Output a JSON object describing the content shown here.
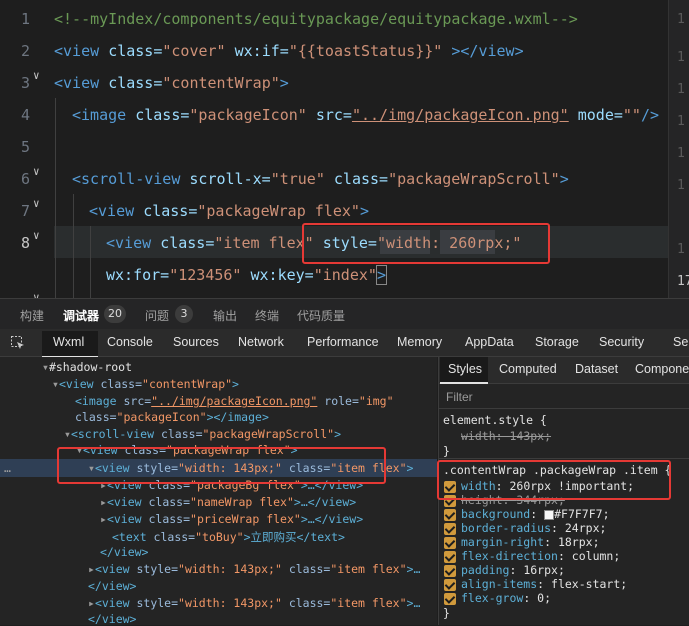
{
  "editor": {
    "line_numbers": [
      "1",
      "2",
      "3",
      "4",
      "5",
      "6",
      "7",
      "8"
    ],
    "lines": {
      "l1": "<!--myIndex/components/equitypackage/equitypackage.wxml-->",
      "l2": {
        "t1": "<view ",
        "a1": "class=",
        "v1": "\"cover\"",
        "a2": " wx:if=",
        "v2": "\"{{toastStatus}}\"",
        "t2": " ></view>"
      },
      "l3": {
        "t1": "<view ",
        "a1": "class=",
        "v1": "\"contentWrap\"",
        "t2": ">"
      },
      "l4": {
        "t1": "<image ",
        "a1": "class=",
        "v1": "\"packageIcon\"",
        "a2": " src=",
        "v2": "\"../img/packageIcon.png\"",
        "a3": " mode=",
        "v3": "\"\"",
        "t2": "/>"
      },
      "l6": {
        "t1": "<scroll-view ",
        "a1": "scroll-x=",
        "v1": "\"true\"",
        "a2": " class=",
        "v2": "\"packageWrapScroll\"",
        "t2": ">"
      },
      "l7": {
        "t1": "<view ",
        "a1": "class=",
        "v1": "\"packageWrap flex\"",
        "t2": ">"
      },
      "l8": {
        "t1": "<view ",
        "a1": "class=",
        "v1": "\"item flex\"",
        "a2": " style=",
        "v2": "\"width: 260rpx;\""
      },
      "l9": {
        "a1": "wx:for=",
        "v1": "\"123456\"",
        "a2": " wx:key=",
        "v2": "\"index\"",
        "t2": ">"
      }
    },
    "right_gutter": [
      "1",
      "1",
      "1",
      "1",
      "1",
      "1",
      "1",
      "17"
    ]
  },
  "panel_tabs": [
    {
      "label": "构建"
    },
    {
      "label": "调试器",
      "badge": "20"
    },
    {
      "label": "问题",
      "badge": "3"
    },
    {
      "label": "输出"
    },
    {
      "label": "终端"
    },
    {
      "label": "代码质量"
    }
  ],
  "devtools_tabs": [
    "Wxml",
    "Console",
    "Sources",
    "Network",
    "Performance",
    "Memory",
    "AppData",
    "Storage",
    "Security",
    "Sen"
  ],
  "tree": {
    "root": "#shadow-root",
    "r1": {
      "t": "<view ",
      "a": "class=",
      "v": "\"contentWrap\"",
      "e": ">"
    },
    "r2a": {
      "t": "<image ",
      "a": "src=",
      "v": "\"../img/packageIcon.png\"",
      "a2": " role=",
      "v2": "\"img\""
    },
    "r2b": {
      "a": "class=",
      "v": "\"packageIcon\"",
      "e": "></image>"
    },
    "r3": {
      "t": "<scroll-view ",
      "a": "class=",
      "v": "\"packageWrapScroll\"",
      "e": ">"
    },
    "r4": {
      "t": "<view ",
      "a": "class=",
      "v": "\"packageWrap flex\"",
      "e": ">"
    },
    "r5": {
      "t": "<view ",
      "a": "style=",
      "v": "\"width: 143px;\"",
      "a2": " class=",
      "v2": "\"item flex\"",
      "e": ">"
    },
    "r6": {
      "t": "<view ",
      "a": "class=",
      "v": "\"packageBg flex\"",
      "e": ">…</view>"
    },
    "r7": {
      "t": "<view ",
      "a": "class=",
      "v": "\"nameWrap flex\"",
      "e": ">…</view>"
    },
    "r8": {
      "t": "<view ",
      "a": "class=",
      "v": "\"priceWrap flex\"",
      "e": ">…</view>"
    },
    "r9": {
      "t": "<text ",
      "a": "class=",
      "v": "\"toBuy\"",
      "e": ">立即购买</text>"
    },
    "r10": "</view>",
    "r11": {
      "t": "<view ",
      "a": "style=",
      "v": "\"width: 143px;\"",
      "a2": " class=",
      "v2": "\"item flex\"",
      "e": ">…"
    },
    "r12": "</view>",
    "r13": {
      "t": "<view ",
      "a": "style=",
      "v": "\"width: 143px;\"",
      "a2": " class=",
      "v2": "\"item flex\"",
      "e": ">…"
    },
    "r14": "</view>",
    "ellipsis": "…"
  },
  "styles": {
    "tabs": [
      "Styles",
      "Computed",
      "Dataset",
      "Componen"
    ],
    "filter_placeholder": "Filter",
    "element_style": {
      "selector": "element.style {",
      "prop": "width",
      "val": "143px;",
      "close": "}"
    },
    "rule": {
      "selector": ".contentWrap .packageWrap .item {",
      "props": [
        {
          "name": "width",
          "value": "260rpx !important;"
        },
        {
          "name": "height",
          "value": "344rpx;"
        },
        {
          "name": "background",
          "value": "#F7F7F7;"
        },
        {
          "name": "border-radius",
          "value": "24rpx;"
        },
        {
          "name": "margin-right",
          "value": "18rpx;"
        },
        {
          "name": "flex-direction",
          "value": "column;"
        },
        {
          "name": "padding",
          "value": "16rpx;"
        },
        {
          "name": "align-items",
          "value": "flex-start;"
        },
        {
          "name": "flex-grow",
          "value": "0;"
        }
      ],
      "close": "}"
    }
  },
  "colors": {
    "highlight_box": "#e53935",
    "checkbox": "#d19a3c",
    "bg_swatch": "#F7F7F7"
  }
}
